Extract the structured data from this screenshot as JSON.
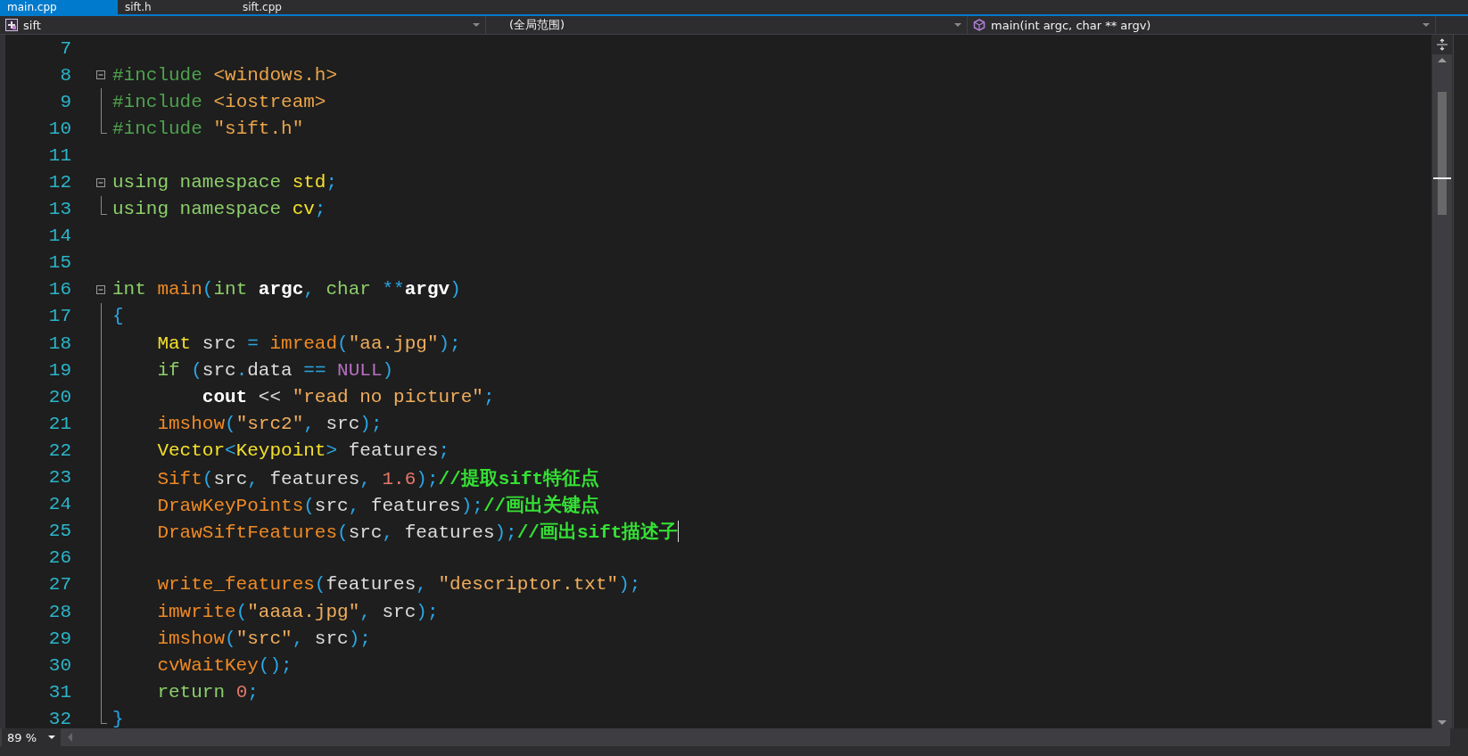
{
  "document_tabs": [
    {
      "label": "main.cpp",
      "selected": true
    },
    {
      "label": "sift.h",
      "selected": false
    },
    {
      "label": "sift.cpp",
      "selected": false
    }
  ],
  "navigation_bar": {
    "project": "sift",
    "scope": "(全局范围)",
    "member": "main(int argc, char ** argv)"
  },
  "editor": {
    "lines": [
      {
        "number": "7",
        "in_region": false,
        "region_end": false
      },
      {
        "number": "8",
        "expanded": true,
        "tokens": [
          {
            "text": "#include",
            "kind": "pp"
          },
          {
            "text": " <windows.h>",
            "kind": "header"
          }
        ]
      },
      {
        "number": "9",
        "in_region": true,
        "region_end": false,
        "tokens": [
          {
            "text": "#include",
            "kind": "pp"
          },
          {
            "text": " <iostream>",
            "kind": "header"
          }
        ]
      },
      {
        "number": "10",
        "in_region": true,
        "region_end": true,
        "tokens": [
          {
            "text": "#include",
            "kind": "pp"
          },
          {
            "text": " \"sift.h\"",
            "kind": "header"
          }
        ]
      },
      {
        "number": "11",
        "in_region": false,
        "region_end": false
      },
      {
        "number": "12",
        "expanded": true,
        "tokens": [
          {
            "text": "using namespace",
            "kind": "keyword"
          },
          {
            "text": " std",
            "kind": "type"
          },
          {
            "text": ";",
            "kind": "punct"
          }
        ]
      },
      {
        "number": "13",
        "in_region": true,
        "region_end": true,
        "tokens": [
          {
            "text": "using namespace",
            "kind": "keyword"
          },
          {
            "text": " cv",
            "kind": "type"
          },
          {
            "text": ";",
            "kind": "punct"
          }
        ]
      },
      {
        "number": "14",
        "in_region": false,
        "region_end": false
      },
      {
        "number": "15",
        "in_region": false,
        "region_end": false
      },
      {
        "number": "16",
        "expanded": true,
        "tokens": [
          {
            "text": "int",
            "kind": "keyword"
          },
          {
            "text": " main",
            "kind": "func"
          },
          {
            "text": "(",
            "kind": "punct"
          },
          {
            "text": "int",
            "kind": "keyword"
          },
          {
            "text": " argc",
            "kind": "param"
          },
          {
            "text": ",",
            "kind": "punct"
          },
          {
            "text": " char",
            "kind": "keyword"
          },
          {
            "text": " **",
            "kind": "punct"
          },
          {
            "text": "argv",
            "kind": "param"
          },
          {
            "text": ")",
            "kind": "punct"
          }
        ]
      },
      {
        "number": "17",
        "in_region": true,
        "region_end": false,
        "tokens": [
          {
            "text": "{",
            "kind": "punct"
          }
        ]
      },
      {
        "number": "18",
        "in_region": true,
        "region_end": false,
        "tokens": [
          {
            "text": "    Mat",
            "kind": "type"
          },
          {
            "text": " src ",
            "kind": "ident"
          },
          {
            "text": "=",
            "kind": "punct"
          },
          {
            "text": " imread",
            "kind": "func"
          },
          {
            "text": "(",
            "kind": "punct"
          },
          {
            "text": "\"aa.jpg\"",
            "kind": "string"
          },
          {
            "text": ");",
            "kind": "punct"
          }
        ]
      },
      {
        "number": "19",
        "in_region": true,
        "region_end": false,
        "tokens": [
          {
            "text": "    if",
            "kind": "keyword"
          },
          {
            "text": " (",
            "kind": "punct"
          },
          {
            "text": "src",
            "kind": "ident"
          },
          {
            "text": ".",
            "kind": "punct"
          },
          {
            "text": "data ",
            "kind": "ident"
          },
          {
            "text": "==",
            "kind": "punct"
          },
          {
            "text": " NULL",
            "kind": "macro"
          },
          {
            "text": ")",
            "kind": "punct"
          }
        ]
      },
      {
        "number": "20",
        "in_region": true,
        "region_end": false,
        "tokens": [
          {
            "text": "        cout",
            "kind": "param"
          },
          {
            "text": " << ",
            "kind": "ident"
          },
          {
            "text": "\"read no picture\"",
            "kind": "string"
          },
          {
            "text": ";",
            "kind": "punct"
          }
        ]
      },
      {
        "number": "21",
        "in_region": true,
        "region_end": false,
        "tokens": [
          {
            "text": "    imshow",
            "kind": "func"
          },
          {
            "text": "(",
            "kind": "punct"
          },
          {
            "text": "\"src2\"",
            "kind": "string"
          },
          {
            "text": ",",
            "kind": "punct"
          },
          {
            "text": " src",
            "kind": "ident"
          },
          {
            "text": ");",
            "kind": "punct"
          }
        ]
      },
      {
        "number": "22",
        "in_region": true,
        "region_end": false,
        "tokens": [
          {
            "text": "    Vector",
            "kind": "type"
          },
          {
            "text": "<",
            "kind": "punct"
          },
          {
            "text": "Keypoint",
            "kind": "type"
          },
          {
            "text": ">",
            "kind": "punct"
          },
          {
            "text": " features",
            "kind": "ident"
          },
          {
            "text": ";",
            "kind": "punct"
          }
        ]
      },
      {
        "number": "23",
        "in_region": true,
        "region_end": false,
        "tokens": [
          {
            "text": "    Sift",
            "kind": "func"
          },
          {
            "text": "(",
            "kind": "punct"
          },
          {
            "text": "src",
            "kind": "ident"
          },
          {
            "text": ",",
            "kind": "punct"
          },
          {
            "text": " features",
            "kind": "ident"
          },
          {
            "text": ",",
            "kind": "punct"
          },
          {
            "text": " 1.6",
            "kind": "number"
          },
          {
            "text": ");",
            "kind": "punct"
          },
          {
            "text": "//提取sift特征点",
            "kind": "comment"
          }
        ]
      },
      {
        "number": "24",
        "in_region": true,
        "region_end": false,
        "tokens": [
          {
            "text": "    DrawKeyPoints",
            "kind": "func"
          },
          {
            "text": "(",
            "kind": "punct"
          },
          {
            "text": "src",
            "kind": "ident"
          },
          {
            "text": ",",
            "kind": "punct"
          },
          {
            "text": " features",
            "kind": "ident"
          },
          {
            "text": ");",
            "kind": "punct"
          },
          {
            "text": "//画出关键点",
            "kind": "comment"
          }
        ]
      },
      {
        "number": "25",
        "in_region": true,
        "region_end": false,
        "caret": true,
        "tokens": [
          {
            "text": "    DrawSiftFeatures",
            "kind": "func"
          },
          {
            "text": "(",
            "kind": "punct"
          },
          {
            "text": "src",
            "kind": "ident"
          },
          {
            "text": ",",
            "kind": "punct"
          },
          {
            "text": " features",
            "kind": "ident"
          },
          {
            "text": ");",
            "kind": "punct"
          },
          {
            "text": "//画出sift描述子",
            "kind": "comment"
          }
        ]
      },
      {
        "number": "26",
        "in_region": true,
        "region_end": false
      },
      {
        "number": "27",
        "in_region": true,
        "region_end": false,
        "tokens": [
          {
            "text": "    write_features",
            "kind": "func"
          },
          {
            "text": "(",
            "kind": "punct"
          },
          {
            "text": "features",
            "kind": "ident"
          },
          {
            "text": ",",
            "kind": "punct"
          },
          {
            "text": " \"descriptor.txt\"",
            "kind": "string"
          },
          {
            "text": ");",
            "kind": "punct"
          }
        ]
      },
      {
        "number": "28",
        "in_region": true,
        "region_end": false,
        "tokens": [
          {
            "text": "    imwrite",
            "kind": "func"
          },
          {
            "text": "(",
            "kind": "punct"
          },
          {
            "text": "\"aaaa.jpg\"",
            "kind": "string"
          },
          {
            "text": ",",
            "kind": "punct"
          },
          {
            "text": " src",
            "kind": "ident"
          },
          {
            "text": ");",
            "kind": "punct"
          }
        ]
      },
      {
        "number": "29",
        "in_region": true,
        "region_end": false,
        "tokens": [
          {
            "text": "    imshow",
            "kind": "func"
          },
          {
            "text": "(",
            "kind": "punct"
          },
          {
            "text": "\"src\"",
            "kind": "string"
          },
          {
            "text": ",",
            "kind": "punct"
          },
          {
            "text": " src",
            "kind": "ident"
          },
          {
            "text": ");",
            "kind": "punct"
          }
        ]
      },
      {
        "number": "30",
        "in_region": true,
        "region_end": false,
        "tokens": [
          {
            "text": "    cvWaitKey",
            "kind": "func"
          },
          {
            "text": "();",
            "kind": "punct"
          }
        ]
      },
      {
        "number": "31",
        "in_region": true,
        "region_end": false,
        "tokens": [
          {
            "text": "    return",
            "kind": "keyword"
          },
          {
            "text": " 0",
            "kind": "number"
          },
          {
            "text": ";",
            "kind": "punct"
          }
        ]
      },
      {
        "number": "32",
        "in_region": true,
        "region_end": true,
        "tokens": [
          {
            "text": "}",
            "kind": "punct"
          }
        ]
      }
    ]
  },
  "zoom": {
    "value": "89 %"
  }
}
